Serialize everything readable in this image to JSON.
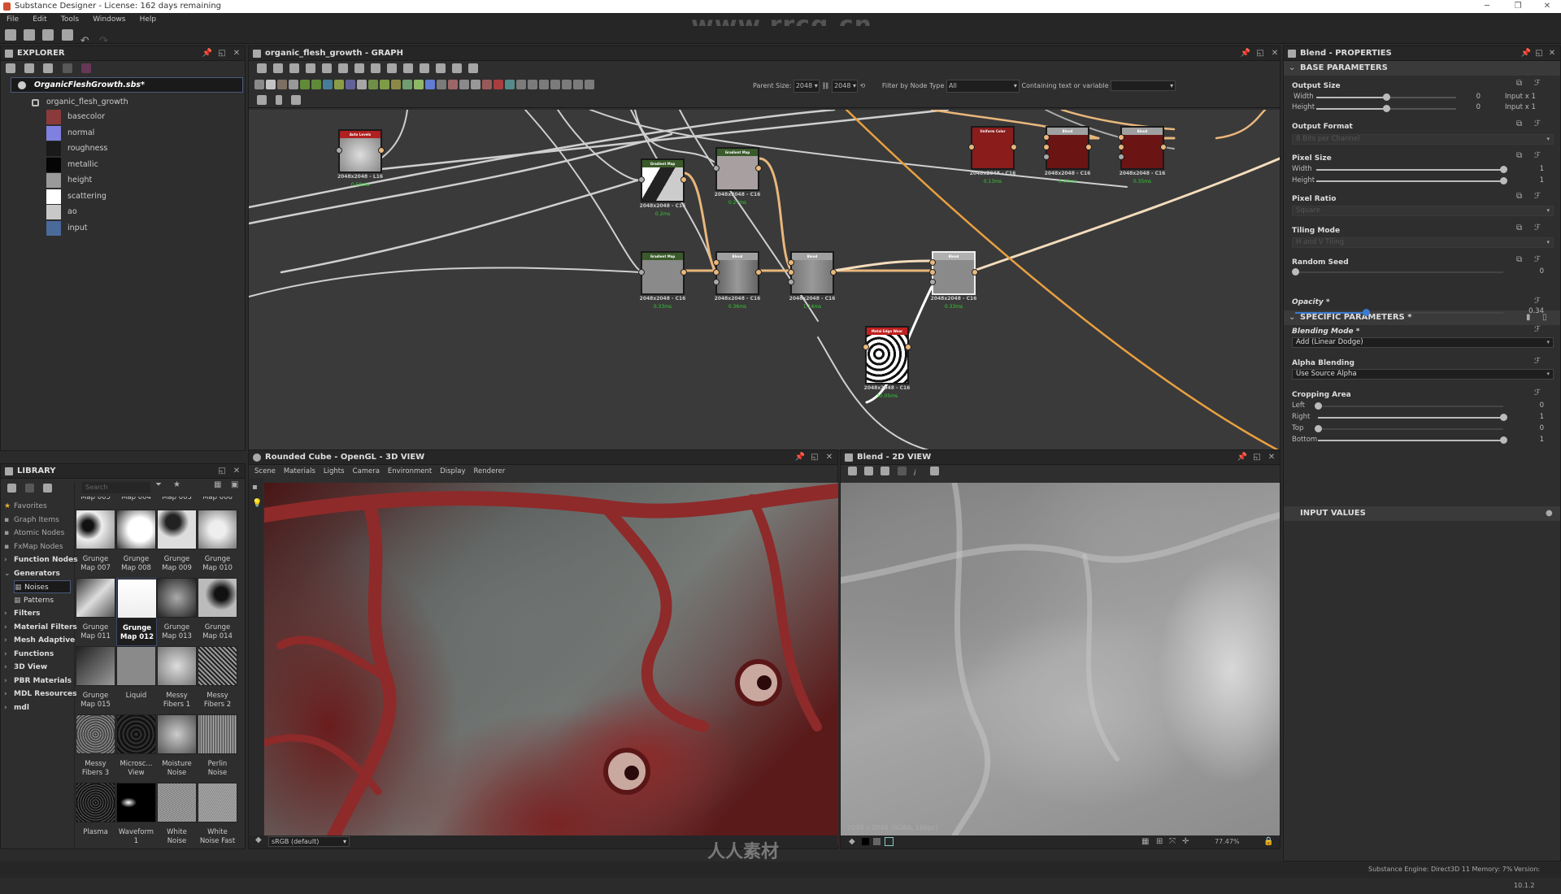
{
  "window": {
    "title": "Substance Designer - License: 162 days remaining",
    "minimize": "─",
    "maximize": "❐",
    "close": "✕"
  },
  "menu": [
    "File",
    "Edit",
    "Tools",
    "Windows",
    "Help"
  ],
  "watermark": {
    "url": "www.rrcg.cn",
    "brand": "人人素材"
  },
  "explorer": {
    "title": "EXPLORER",
    "package": "OrganicFleshGrowth.sbs*",
    "graph": "organic_flesh_growth",
    "outputs": [
      {
        "label": "basecolor",
        "color": "#8a3a3a"
      },
      {
        "label": "normal",
        "color": "#8080e0"
      },
      {
        "label": "roughness",
        "color": "#1a1a1a"
      },
      {
        "label": "metallic",
        "color": "#050505"
      },
      {
        "label": "height",
        "color": "#9a9a9a"
      },
      {
        "label": "scattering",
        "color": "#ffffff"
      },
      {
        "label": "ao",
        "color": "#c8c8c8"
      },
      {
        "label": "input",
        "color": "#4a6a9a"
      }
    ]
  },
  "graph": {
    "title": "organic_flesh_growth - GRAPH",
    "parent_size_label": "Parent Size:",
    "parent_width": "2048",
    "parent_height": "2048",
    "filter_label": "Filter by Node Type",
    "filter_value": "All",
    "containing_label": "Containing text or variable",
    "containing_value": "",
    "nodes": [
      {
        "id": "auto-levels",
        "title": "Auto Levels",
        "header": "#b02020",
        "res": "2048x2048 - L16",
        "time": "0.58ms"
      },
      {
        "id": "gradient-map-1",
        "title": "Gradient Map",
        "header": "#3a5a2a",
        "res": "2048x2048 - C16",
        "time": "0.2ms"
      },
      {
        "id": "gradient-map-2",
        "title": "Gradient Map",
        "header": "#3a5a2a",
        "res": "2048x2048 - C16",
        "time": "0.27ms"
      },
      {
        "id": "gradient-map-3",
        "title": "Gradient Map",
        "header": "#3a5a2a",
        "res": "2048x2048 - C16",
        "time": "0.33ms"
      },
      {
        "id": "blend-1",
        "title": "Blend",
        "header": "#a0a0a0",
        "res": "2048x2048 - C16",
        "time": "0.36ms"
      },
      {
        "id": "blend-2",
        "title": "Blend",
        "header": "#a0a0a0",
        "res": "2048x2048 - C16",
        "time": "1.14ms"
      },
      {
        "id": "blend-selected",
        "title": "Blend",
        "header": "#b0b0b0",
        "res": "2048x2048 - C16",
        "time": "0.33ms"
      },
      {
        "id": "uniform-color",
        "title": "Uniform Color",
        "header": "#8a1c1c",
        "res": "2048x2048 - C16",
        "time": "0.13ms"
      },
      {
        "id": "blend-red-1",
        "title": "Blend",
        "header": "#a0a0a0",
        "res": "2048x2048 - C16",
        "time": "0.44ms"
      },
      {
        "id": "blend-red-2",
        "title": "Blend",
        "header": "#a0a0a0",
        "res": "2048x2048 - C16",
        "time": "0.35ms"
      },
      {
        "id": "metal-edge-wear",
        "title": "Metal Edge Wear",
        "header": "#c02020",
        "res": "2048x2048 - C16",
        "time": "30.05ms"
      }
    ]
  },
  "properties": {
    "title": "Blend - PROPERTIES",
    "base_section": "BASE PARAMETERS",
    "output_size": {
      "label": "Output Size",
      "width_label": "Width",
      "height_label": "Height",
      "width_value": "0",
      "height_value": "0",
      "width_mode": "Input x 1",
      "height_mode": "Input x 1",
      "width_pos": 0.5,
      "height_pos": 0.5
    },
    "output_format": {
      "label": "Output Format",
      "value": "8 Bits per Channel"
    },
    "pixel_size": {
      "label": "Pixel Size",
      "width_label": "Width",
      "height_label": "Height",
      "width_value": "1",
      "height_value": "1"
    },
    "pixel_ratio": {
      "label": "Pixel Ratio",
      "value": "Square"
    },
    "tiling_mode": {
      "label": "Tiling Mode",
      "value": "H and V Tiling"
    },
    "random_seed": {
      "label": "Random Seed",
      "value": "0"
    },
    "specific_section": "SPECIFIC PARAMETERS *",
    "opacity": {
      "label": "Opacity *",
      "value": "0.34",
      "fraction": 0.34
    },
    "blending_mode": {
      "label": "Blending Mode *",
      "value": "Add (Linear Dodge)"
    },
    "alpha_blending": {
      "label": "Alpha Blending",
      "value": "Use Source Alpha"
    },
    "cropping": {
      "label": "Cropping Area",
      "left_label": "Left",
      "right_label": "Right",
      "top_label": "Top",
      "bottom_label": "Bottom",
      "left": "0",
      "right": "1",
      "top": "0",
      "bottom": "1"
    },
    "input_section": "INPUT VALUES"
  },
  "library": {
    "title": "LIBRARY",
    "search_placeholder": "Search",
    "categories": [
      {
        "label": "Favorites",
        "kind": "fav"
      },
      {
        "label": "Graph Items",
        "kind": "fav"
      },
      {
        "label": "Atomic Nodes",
        "kind": "fav"
      },
      {
        "label": "FxMap Nodes",
        "kind": "fav"
      },
      {
        "label": "Function Nodes",
        "kind": "cat"
      },
      {
        "label": "Generators",
        "kind": "open"
      },
      {
        "label": "Noises",
        "kind": "sub-selected"
      },
      {
        "label": "Patterns",
        "kind": "sub"
      },
      {
        "label": "Filters",
        "kind": "cat"
      },
      {
        "label": "Material Filters",
        "kind": "cat"
      },
      {
        "label": "Mesh Adaptive",
        "kind": "cat"
      },
      {
        "label": "Functions",
        "kind": "cat"
      },
      {
        "label": "3D View",
        "kind": "cat"
      },
      {
        "label": "PBR Materials",
        "kind": "cat"
      },
      {
        "label": "MDL Resources",
        "kind": "cat"
      },
      {
        "label": "mdl",
        "kind": "cat"
      }
    ],
    "partial_row": [
      "Map 005",
      "Map 004",
      "Map 003",
      "Map 006"
    ],
    "items": [
      {
        "label": "Grunge Map 007"
      },
      {
        "label": "Grunge Map 008"
      },
      {
        "label": "Grunge Map 009"
      },
      {
        "label": "Grunge Map 010"
      },
      {
        "label": "Grunge Map 011"
      },
      {
        "label": "Grunge Map 012",
        "selected": true
      },
      {
        "label": "Grunge Map 013"
      },
      {
        "label": "Grunge Map 014"
      },
      {
        "label": "Grunge Map 015"
      },
      {
        "label": "Liquid"
      },
      {
        "label": "Messy Fibers 1"
      },
      {
        "label": "Messy Fibers 2"
      },
      {
        "label": "Messy Fibers 3"
      },
      {
        "label": "Microsc... View"
      },
      {
        "label": "Moisture Noise"
      },
      {
        "label": "Perlin Noise"
      },
      {
        "label": "Plasma"
      },
      {
        "label": "Waveform 1"
      },
      {
        "label": "White Noise"
      },
      {
        "label": "White Noise Fast"
      }
    ]
  },
  "view3d": {
    "title": "Rounded Cube - OpenGL - 3D VIEW",
    "menu": [
      "Scene",
      "Materials",
      "Lights",
      "Camera",
      "Environment",
      "Display",
      "Renderer"
    ],
    "colorspace": "sRGB (default)"
  },
  "view2d": {
    "title": "Blend - 2D VIEW",
    "image_info": "2048 x 2048 (RGBA, 16bpc)",
    "zoom": "77.47%"
  },
  "status": {
    "engine": "Substance Engine: Direct3D 11 Memory: 7%",
    "version": "Version: 10.1.2"
  }
}
